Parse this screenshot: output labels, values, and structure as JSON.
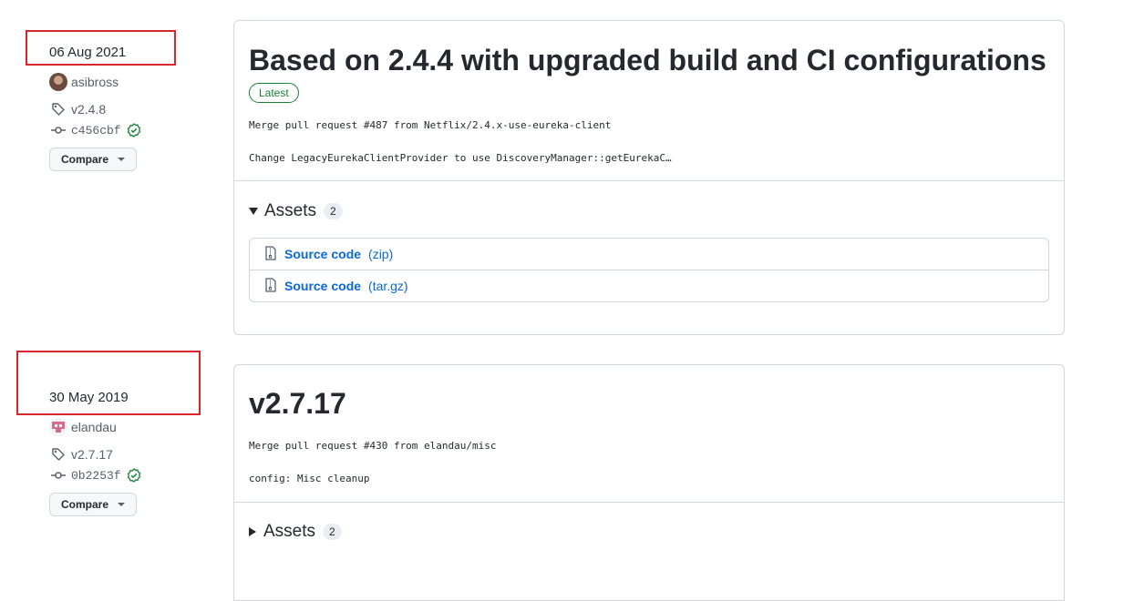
{
  "releases": [
    {
      "date": "06 Aug 2021",
      "author": "asibross",
      "tag": "v2.4.8",
      "commit": "c456cbf",
      "compare_label": "Compare",
      "title": "Based on 2.4.4 with upgraded build and CI configurations",
      "badge": "Latest",
      "notes": [
        "Merge pull request #487 from Netflix/2.4.x-use-eureka-client",
        "Change LegacyEurekaClientProvider to use DiscoveryManager::getEurekaC…"
      ],
      "assets_label": "Assets",
      "assets_count": "2",
      "assets_expanded": true,
      "assets": [
        {
          "name": "Source code",
          "ext": "(zip)"
        },
        {
          "name": "Source code",
          "ext": "(tar.gz)"
        }
      ]
    },
    {
      "date": "30 May 2019",
      "author": "elandau",
      "tag": "v2.7.17",
      "commit": "0b2253f",
      "compare_label": "Compare",
      "title": "v2.7.17",
      "notes": [
        "Merge pull request #430 from elandau/misc",
        "config: Misc cleanup"
      ],
      "assets_label": "Assets",
      "assets_count": "2",
      "assets_expanded": false
    }
  ],
  "colors": {
    "highlight": "#d9262a",
    "link": "#0969da",
    "success": "#1a7f37",
    "border": "#d0d7de"
  }
}
